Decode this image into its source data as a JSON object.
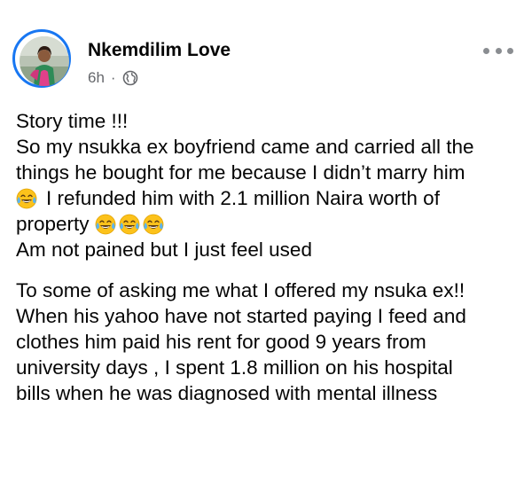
{
  "post": {
    "author": {
      "name": "Nkemdilim Love",
      "avatar_icon": "profile-photo-avatar"
    },
    "meta": {
      "time": "6h",
      "separator": "·",
      "audience_icon": "globe-icon"
    },
    "more_icon": "more-horizontal-icon",
    "paragraphs": [
      {
        "lines": [
          "Story time !!!",
          "So my nsukka ex boyfriend came and carried all the",
          "things he bought for me because I didn’t marry him",
          "I refunded him with 2.1 million Naira worth of",
          "property",
          "Am not pained but I just feel used"
        ]
      },
      {
        "lines": [
          "To some of asking me what I offered my nsuka ex!!",
          "When his yahoo have not started paying I feed and",
          "clothes him paid his rent for good 9 years from",
          "university days , I spent 1.8 million on his hospital",
          "bills when he was diagnosed with mental illness"
        ]
      }
    ],
    "emoji_name": "face-with-tears-of-joy-emoji"
  },
  "colors": {
    "ring": "#1877f2",
    "text": "#050505",
    "secondary": "#65676b",
    "emoji_face": "#fcc21b"
  }
}
